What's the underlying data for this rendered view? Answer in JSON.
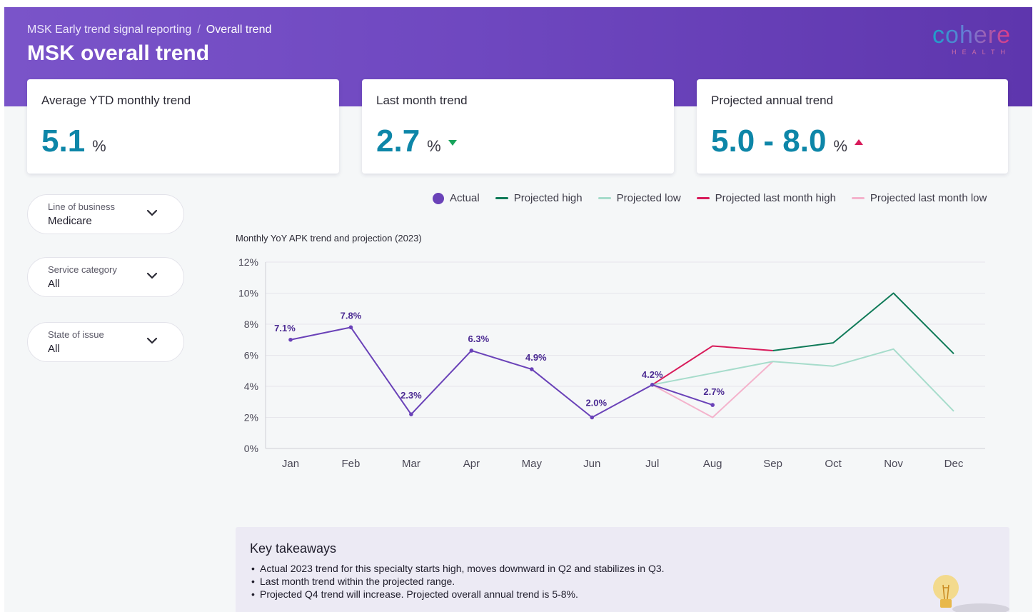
{
  "header": {
    "breadcrumb_parent": "MSK Early trend signal reporting",
    "breadcrumb_sep": "/",
    "breadcrumb_current": "Overall trend",
    "title": "MSK overall trend",
    "logo_word": "cohere",
    "logo_sub": "HEALTH"
  },
  "cards": [
    {
      "label": "Average YTD monthly trend",
      "value": "5.1",
      "unit": "%",
      "indicator": "none"
    },
    {
      "label": "Last month trend",
      "value": "2.7",
      "unit": "%",
      "indicator": "down-green"
    },
    {
      "label": "Projected annual trend",
      "value": "5.0 - 8.0",
      "unit": "%",
      "indicator": "up-red"
    }
  ],
  "filters": [
    {
      "label": "Line of business",
      "value": "Medicare"
    },
    {
      "label": "Service category",
      "value": "All"
    },
    {
      "label": "State of issue",
      "value": "All"
    }
  ],
  "colors": {
    "actual": "#6a42b8",
    "projected_high": "#0f7a58",
    "projected_low": "#a6dccb",
    "projected_last_month_high": "#d81b5a",
    "projected_last_month_low": "#f4b3cc",
    "value_blue": "#0d86a8"
  },
  "chart_data": {
    "type": "line",
    "title": "Monthly YoY APK trend and projection (2023)",
    "categories": [
      "Jan",
      "Feb",
      "Mar",
      "Apr",
      "May",
      "Jun",
      "Jul",
      "Aug",
      "Sep",
      "Oct",
      "Nov",
      "Dec"
    ],
    "ylim": [
      0,
      12
    ],
    "yticks": [
      0,
      2,
      4,
      6,
      8,
      10,
      12
    ],
    "ytick_format": "%",
    "grid": true,
    "legend_position": "top",
    "series": [
      {
        "name": "Actual",
        "key": "actual",
        "style": "line-with-dots",
        "values": [
          7.0,
          7.8,
          2.2,
          6.3,
          5.1,
          2.0,
          4.1,
          2.8,
          null,
          null,
          null,
          null
        ],
        "labels": [
          "7.1%",
          "7.8%",
          "2.3%",
          "6.3%",
          "4.9%",
          "2.0%",
          "4.2%",
          "2.7%",
          null,
          null,
          null,
          null
        ]
      },
      {
        "name": "Projected high",
        "key": "projected_high",
        "values": [
          null,
          null,
          null,
          null,
          null,
          null,
          null,
          null,
          6.3,
          6.8,
          10.0,
          6.1
        ]
      },
      {
        "name": "Projected low",
        "key": "projected_low",
        "values": [
          null,
          null,
          null,
          null,
          null,
          null,
          4.1,
          null,
          5.6,
          5.3,
          6.4,
          2.4
        ]
      },
      {
        "name": "Projected last month high",
        "key": "projected_last_month_high",
        "values": [
          null,
          null,
          null,
          null,
          null,
          null,
          4.1,
          6.6,
          6.3,
          null,
          null,
          null
        ]
      },
      {
        "name": "Projected last month low",
        "key": "projected_last_month_low",
        "values": [
          null,
          null,
          null,
          null,
          null,
          null,
          4.1,
          2.0,
          5.6,
          null,
          null,
          null
        ]
      }
    ]
  },
  "takeaways": {
    "title": "Key takeaways",
    "items": [
      "Actual 2023 trend for this specialty starts high, moves downward in Q2 and stabilizes in Q3.",
      "Last month trend within the projected range.",
      "Projected Q4 trend will increase. Projected overall annual trend is 5-8%."
    ]
  }
}
